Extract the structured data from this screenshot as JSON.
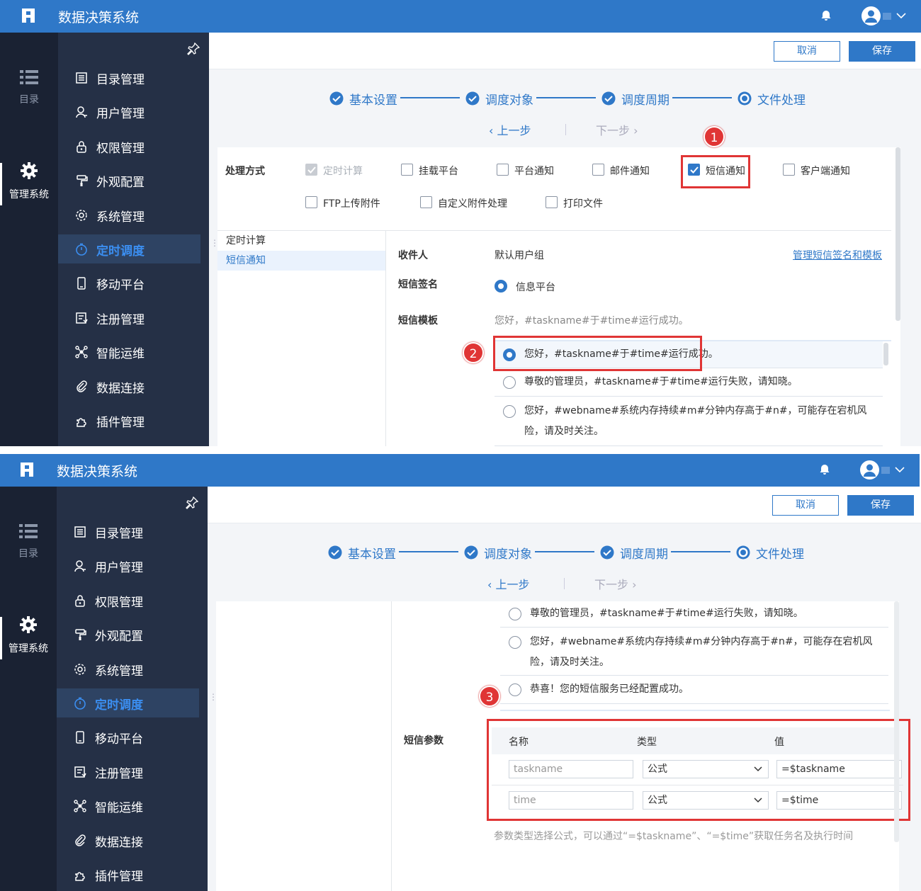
{
  "app": {
    "title": "数据决策系统"
  },
  "rail": {
    "catalog_label": "目录",
    "admin_label": "管理系统"
  },
  "menu": {
    "items": [
      {
        "label": "目录管理",
        "icon": "catalog-icon"
      },
      {
        "label": "用户管理",
        "icon": "user-icon"
      },
      {
        "label": "权限管理",
        "icon": "lock-icon"
      },
      {
        "label": "外观配置",
        "icon": "paint-roller-icon"
      },
      {
        "label": "系统管理",
        "icon": "gear-icon"
      },
      {
        "label": "定时调度",
        "icon": "timer-icon",
        "active": true
      },
      {
        "label": "移动平台",
        "icon": "mobile-icon"
      },
      {
        "label": "注册管理",
        "icon": "register-icon"
      },
      {
        "label": "智能运维",
        "icon": "network-icon"
      },
      {
        "label": "数据连接",
        "icon": "link-icon"
      },
      {
        "label": "插件管理",
        "icon": "plugin-icon"
      }
    ]
  },
  "toolbar": {
    "cancel_label": "取消",
    "save_label": "保存"
  },
  "steps": [
    {
      "label": "基本设置",
      "state": "done"
    },
    {
      "label": "调度对象",
      "state": "done"
    },
    {
      "label": "调度周期",
      "state": "done"
    },
    {
      "label": "文件处理",
      "state": "current"
    }
  ],
  "stepnav": {
    "prev": "上一步",
    "next": "下一步"
  },
  "processing": {
    "label": "处理方式",
    "options": [
      {
        "label": "定时计算",
        "checked": true,
        "disabled": true
      },
      {
        "label": "挂载平台",
        "checked": false
      },
      {
        "label": "平台通知",
        "checked": false
      },
      {
        "label": "邮件通知",
        "checked": false
      },
      {
        "label": "短信通知",
        "checked": true
      },
      {
        "label": "客户端通知",
        "checked": false
      },
      {
        "label": "FTP上传附件",
        "checked": false
      },
      {
        "label": "自定义附件处理",
        "checked": false
      },
      {
        "label": "打印文件",
        "checked": false
      }
    ]
  },
  "tree": [
    {
      "label": "定时计算"
    },
    {
      "label": "短信通知",
      "selected": true
    }
  ],
  "sms": {
    "recipient_label": "收件人",
    "recipient_value": "默认用户组",
    "manage_link": "管理短信签名和模板",
    "signature_label": "短信签名",
    "signature_value": "信息平台",
    "template_label": "短信模板",
    "template_selected": "您好，#taskname#于#time#运行成功。",
    "templates": [
      "您好，#taskname#于#time#运行成功。",
      "尊敬的管理员，#taskname#于#time#运行失败，请知晓。",
      "您好，#webname#系统内存持续#m#分钟内存高于#n#，可能存在宕机风险，请及时关注。",
      "恭喜！您的短信服务已经配置成功。"
    ],
    "params_label": "短信参数",
    "params_headers": {
      "name": "名称",
      "type": "类型",
      "value": "值"
    },
    "params": [
      {
        "name": "taskname",
        "type": "公式",
        "value": "=$taskname"
      },
      {
        "name": "time",
        "type": "公式",
        "value": "=$time"
      }
    ],
    "params_hint": "参数类型选择公式，可以通过“=$taskname”、“=$time”获取任务名及执行时间"
  },
  "callouts": [
    "1",
    "2",
    "3"
  ],
  "colors": {
    "brand": "#2f78c8",
    "sidebar": "#1a2233",
    "menu": "#253046",
    "callout": "#e03535"
  }
}
